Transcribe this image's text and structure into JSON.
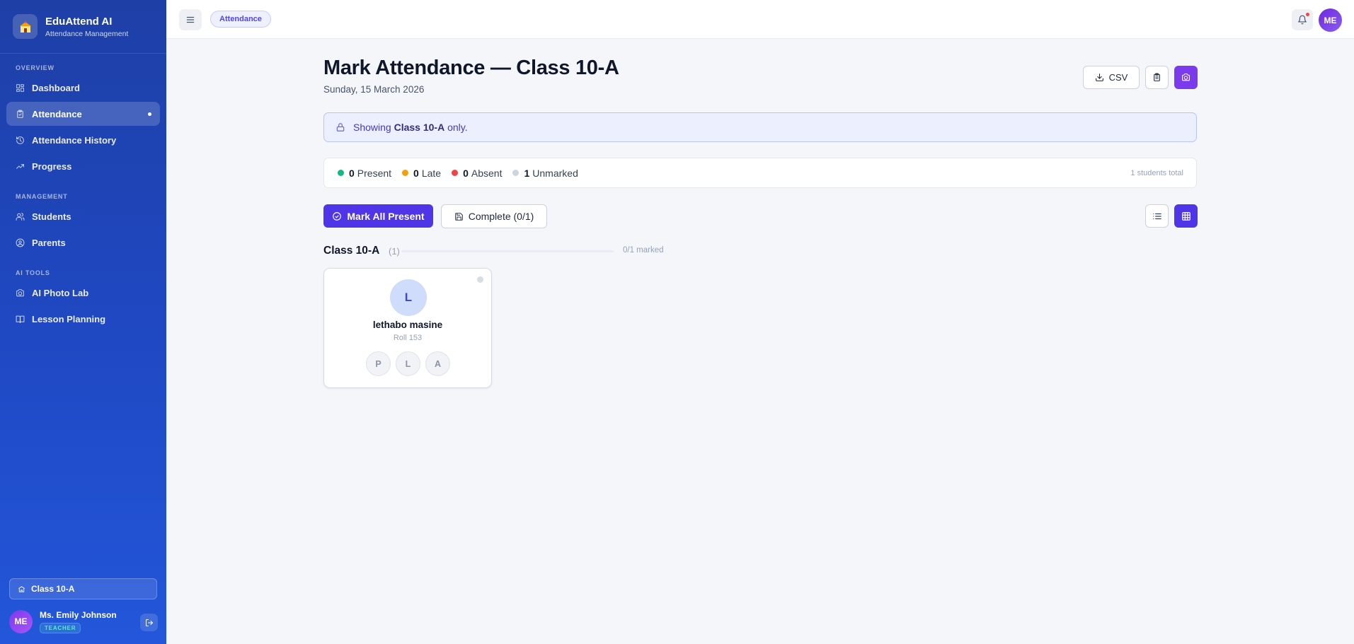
{
  "app": {
    "title": "EduAttend AI",
    "subtitle": "Attendance Management"
  },
  "sidebar": {
    "sections": [
      "OVERVIEW",
      "MANAGEMENT",
      "AI TOOLS"
    ],
    "items": [
      {
        "label": "Dashboard",
        "icon": "dashboard-icon"
      },
      {
        "label": "Attendance",
        "icon": "clipboard-check-icon",
        "active": true
      },
      {
        "label": "Attendance History",
        "icon": "history-icon"
      },
      {
        "label": "Progress",
        "icon": "trending-up-icon"
      },
      {
        "label": "Students",
        "icon": "users-icon"
      },
      {
        "label": "Parents",
        "icon": "user-circle-icon"
      },
      {
        "label": "AI Photo Lab",
        "icon": "camera-icon"
      },
      {
        "label": "Lesson Planning",
        "icon": "book-open-icon"
      }
    ],
    "class_chip": "Class 10-A",
    "user": {
      "initials": "ME",
      "name": "Ms. Emily Johnson",
      "role": "TEACHER"
    }
  },
  "topbar": {
    "breadcrumb": "Attendance",
    "avatar_initials": "ME",
    "has_notification": true
  },
  "page": {
    "title": "Mark Attendance — Class 10-A",
    "date": "Sunday, 15 March 2026",
    "csv_label": "CSV"
  },
  "notice": {
    "prefix": "Showing",
    "class_name": "Class 10-A",
    "suffix": "only."
  },
  "stats": {
    "present": {
      "count": "0",
      "label": "Present",
      "color": "#10b981"
    },
    "late": {
      "count": "0",
      "label": "Late",
      "color": "#f59e0b"
    },
    "absent": {
      "count": "0",
      "label": "Absent",
      "color": "#ef4444"
    },
    "unmarked": {
      "count": "1",
      "label": "Unmarked",
      "color": "#cbd5e1"
    },
    "total": "1 students total"
  },
  "actions": {
    "mark_all": "Mark All Present",
    "complete": "Complete (0/1)"
  },
  "group": {
    "title": "Class 10-A",
    "count": "(1)",
    "marked": "0/1 marked"
  },
  "students": [
    {
      "initial": "L",
      "name": "lethabo masine",
      "roll": "Roll 153",
      "marks": [
        "P",
        "L",
        "A"
      ]
    }
  ],
  "colors": {
    "primary": "#4f35e8",
    "accent_purple": "#7c3aed",
    "sidebar": "#1f48c2"
  }
}
